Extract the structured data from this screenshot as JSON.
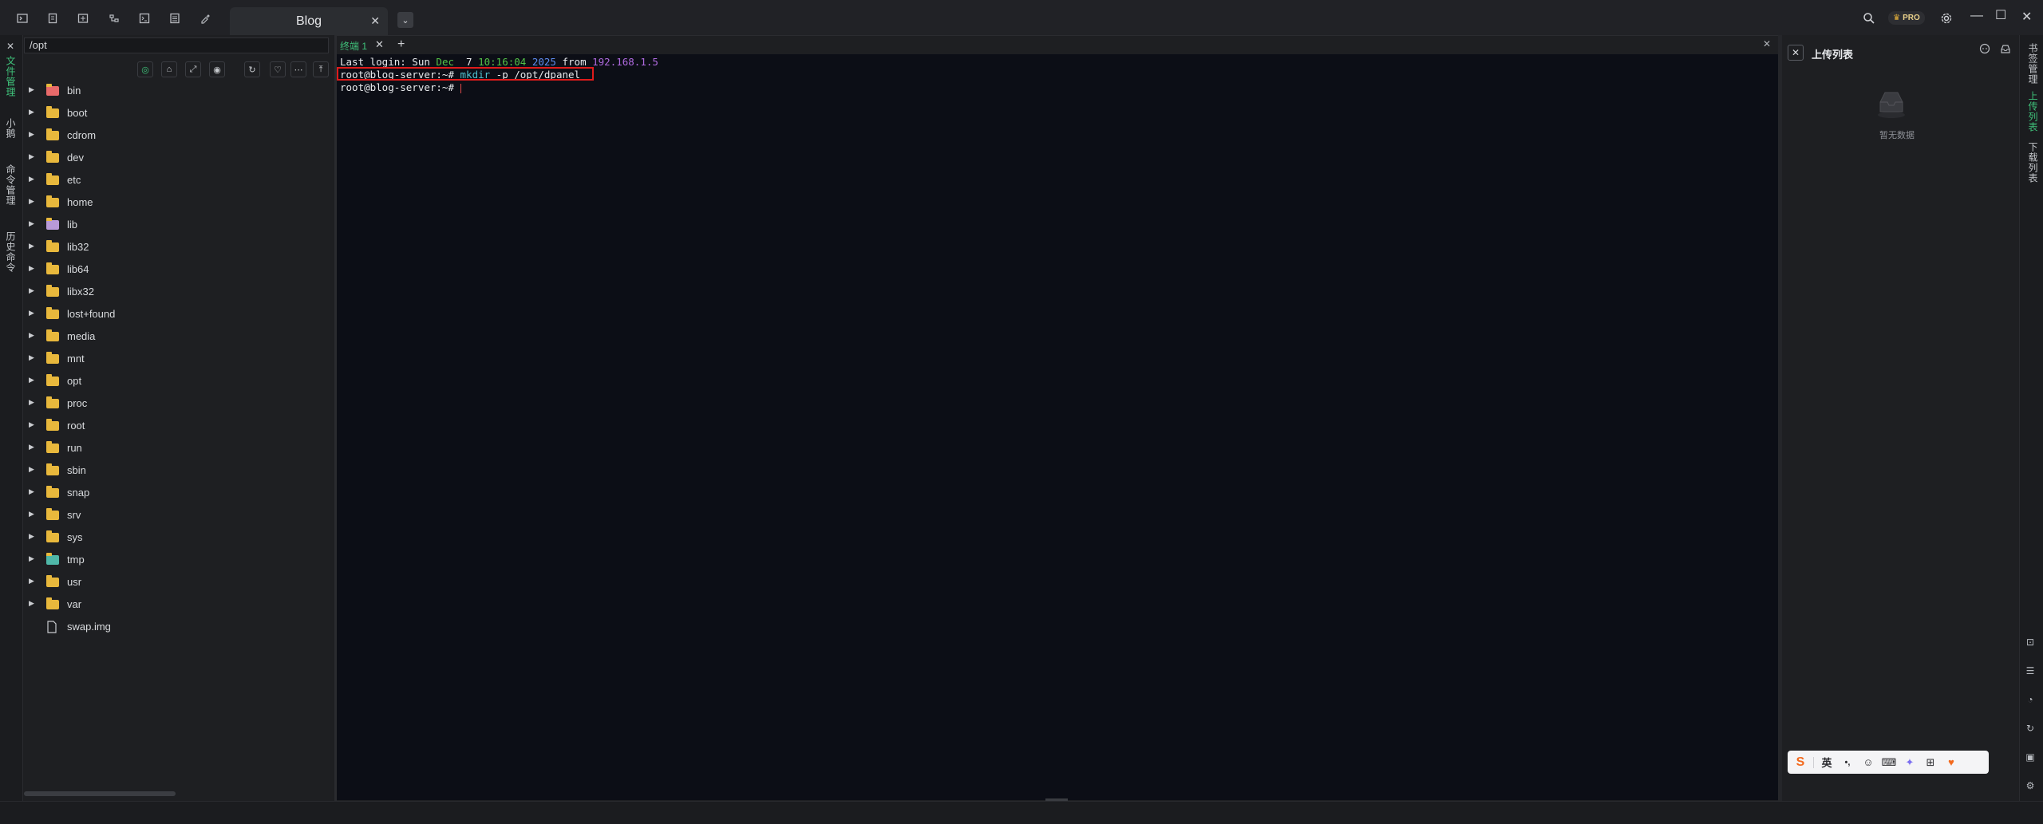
{
  "titlebar": {
    "tab_title": "Blog",
    "pro_badge": "PRO",
    "icons": [
      "terminal-icon",
      "file-icon",
      "sftp-icon",
      "network-icon",
      "code-icon",
      "list-icon",
      "brush-icon",
      "search-icon",
      "settings-icon",
      "minimize-icon",
      "maximize-icon",
      "close-icon"
    ]
  },
  "left_rail": {
    "tabs": [
      {
        "label": "文件管理",
        "active": true
      },
      {
        "label": "小鹅",
        "active": false
      },
      {
        "label": "命令管理",
        "active": false
      },
      {
        "label": "历史命令",
        "active": false
      }
    ]
  },
  "file_panel": {
    "path": "/opt",
    "items": [
      {
        "name": "bin",
        "type": "folder-special"
      },
      {
        "name": "boot",
        "type": "folder"
      },
      {
        "name": "cdrom",
        "type": "folder"
      },
      {
        "name": "dev",
        "type": "folder"
      },
      {
        "name": "etc",
        "type": "folder"
      },
      {
        "name": "home",
        "type": "folder"
      },
      {
        "name": "lib",
        "type": "folder-special"
      },
      {
        "name": "lib32",
        "type": "folder"
      },
      {
        "name": "lib64",
        "type": "folder"
      },
      {
        "name": "libx32",
        "type": "folder"
      },
      {
        "name": "lost+found",
        "type": "folder"
      },
      {
        "name": "media",
        "type": "folder"
      },
      {
        "name": "mnt",
        "type": "folder"
      },
      {
        "name": "opt",
        "type": "folder"
      },
      {
        "name": "proc",
        "type": "folder"
      },
      {
        "name": "root",
        "type": "folder"
      },
      {
        "name": "run",
        "type": "folder"
      },
      {
        "name": "sbin",
        "type": "folder"
      },
      {
        "name": "snap",
        "type": "folder"
      },
      {
        "name": "srv",
        "type": "folder"
      },
      {
        "name": "sys",
        "type": "folder"
      },
      {
        "name": "tmp",
        "type": "folder-tmp"
      },
      {
        "name": "usr",
        "type": "folder"
      },
      {
        "name": "var",
        "type": "folder"
      },
      {
        "name": "swap.img",
        "type": "file"
      }
    ]
  },
  "terminal": {
    "tab_label": "终端 1",
    "line1": {
      "a": "Last login: Sun ",
      "dec": "Dec",
      "day": "  7 ",
      "time": "10:16:04",
      "year": " 2025",
      "from": " from ",
      "ip": "192.168.1.5"
    },
    "line2": {
      "prompt": "root@blog-server:~# ",
      "cmd": "mkdir",
      "args": " -p /opt/dpanel"
    },
    "line3": {
      "prompt": "root@blog-server:~# "
    }
  },
  "upload_panel": {
    "title": "上传列表",
    "empty_text": "暂无数据"
  },
  "right_rail": {
    "tabs": [
      {
        "label": "书签管理"
      },
      {
        "label": "上传列表"
      },
      {
        "label": "下载列表"
      }
    ]
  },
  "ime": {
    "lang": "英",
    "punct": "•,"
  },
  "colors": {
    "accent_green": "#3fc27a",
    "folder": "#e8b83c",
    "highlight_box": "#e01b1b",
    "terminal_bg": "#0c0e16"
  }
}
